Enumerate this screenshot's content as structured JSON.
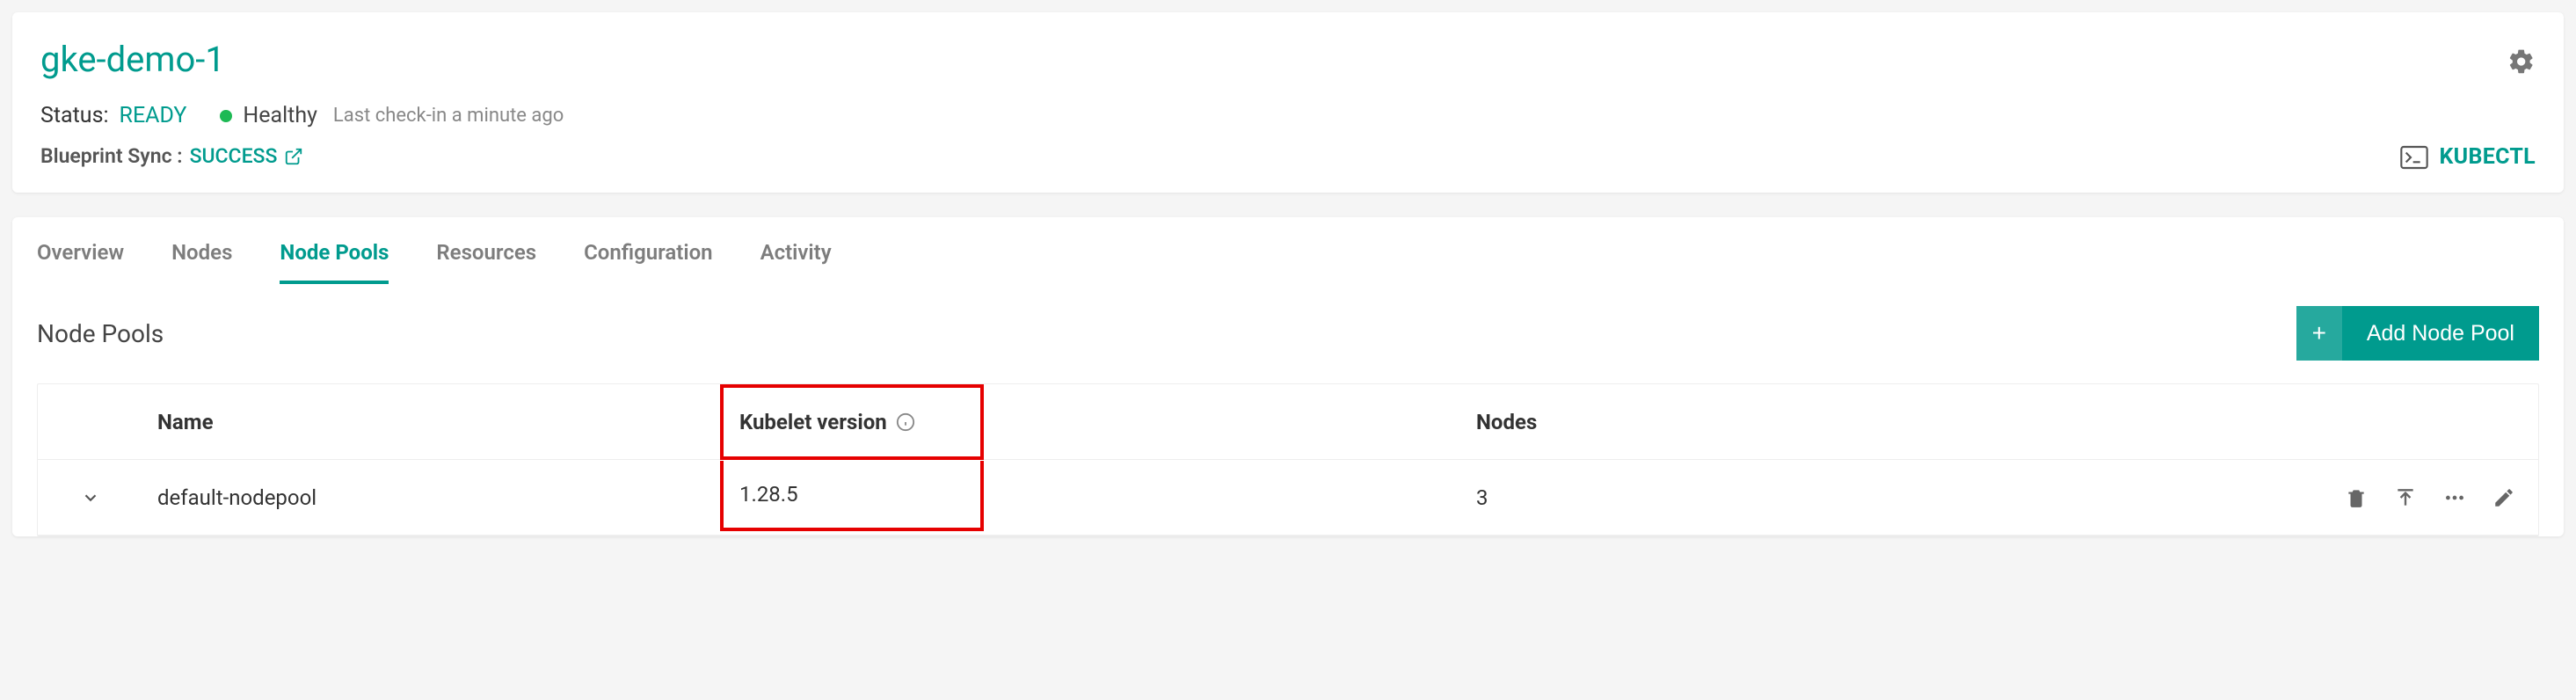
{
  "cluster": {
    "name": "gke-demo-1",
    "status_label": "Status:",
    "status_value": "READY",
    "health_text": "Healthy",
    "checkin": "Last check-in a minute ago",
    "blueprint_label": "Blueprint Sync :",
    "blueprint_value": "SUCCESS",
    "kubectl_label": "KUBECTL"
  },
  "tabs": {
    "overview": "Overview",
    "nodes": "Nodes",
    "node_pools": "Node Pools",
    "resources": "Resources",
    "configuration": "Configuration",
    "activity": "Activity"
  },
  "section": {
    "title": "Node Pools",
    "add_button": "Add Node Pool"
  },
  "table": {
    "headers": {
      "name": "Name",
      "kubelet": "Kubelet version",
      "nodes": "Nodes"
    },
    "rows": [
      {
        "name": "default-nodepool",
        "kubelet": "1.28.5",
        "nodes": "3"
      }
    ]
  }
}
